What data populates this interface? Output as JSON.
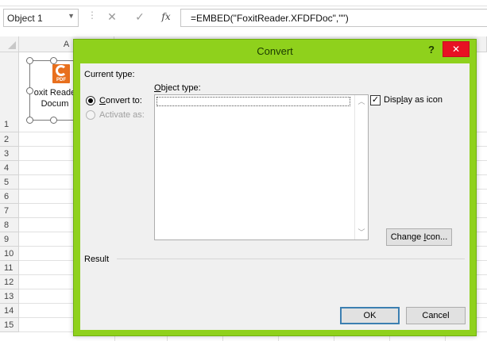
{
  "formula_bar": {
    "name_box": "Object 1",
    "cancel_glyph": "✕",
    "enter_glyph": "✓",
    "fx_label": "fx",
    "formula": "=EMBED(\"FoxitReader.XFDFDoc\",\"\")"
  },
  "sheet": {
    "column_headers": [
      "A"
    ],
    "row_headers": [
      "1",
      "2",
      "3",
      "4",
      "5",
      "6",
      "7",
      "8",
      "9",
      "10",
      "11",
      "12",
      "13",
      "14",
      "15"
    ],
    "embedded_object": {
      "icon_label": "PDF",
      "caption_line1": "oxit Reade",
      "caption_line2": "Docum"
    }
  },
  "dialog": {
    "title": "Convert",
    "help": "?",
    "close": "✕",
    "current_type_label": "Current type:",
    "object_type_label_pre": "",
    "object_type_label_ul": "O",
    "object_type_label_post": "bject type:",
    "convert_to_pre": "",
    "convert_to_ul": "C",
    "convert_to_post": "onvert to:",
    "activate_as": "Activate as:",
    "display_as_icon_pre": "Disp",
    "display_as_icon_ul": "l",
    "display_as_icon_post": "ay as icon",
    "display_as_icon_checked": true,
    "change_icon_pre": "Change ",
    "change_icon_ul": "I",
    "change_icon_post": "con...",
    "result_label": "Result",
    "ok": "OK",
    "cancel": "Cancel",
    "accent_color": "#8fd11c",
    "close_color": "#e81123"
  }
}
